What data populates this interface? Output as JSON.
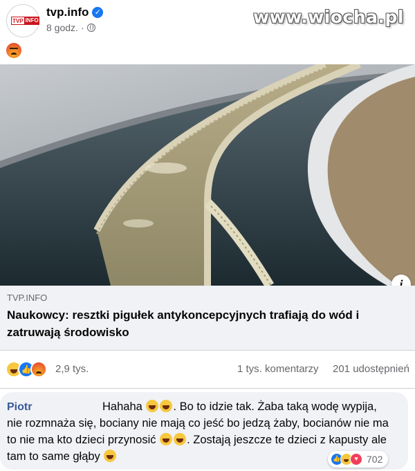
{
  "post": {
    "page_name": "tvp.info",
    "time": "8 godz.",
    "separator": "·",
    "avatar_logo_left": "TVP",
    "avatar_logo_right": "INFO",
    "verified_icon": "check-icon",
    "privacy_icon": "globe-icon",
    "header_emoji": "angry-icon"
  },
  "watermark": "www.wiocha.pl",
  "link": {
    "domain": "TVP.INFO",
    "title": "Naukowcy: resztki pigułek antykoncepcyjnych trafiają do wód i zatruwają środowisko",
    "info_label": "i"
  },
  "reactions": {
    "icons": [
      "laugh-icon",
      "like-icon",
      "angry-icon"
    ],
    "count": "2,9 tys.",
    "comments": "1 tys. komentarzy",
    "shares": "201 udostępnień"
  },
  "comment": {
    "author": "Piotr",
    "text_part1": "Hahaha",
    "text_part2": ". Bo to idzie tak. Żaba taką wodę wypija, nie rozmnaża się, bociany nie mają co jeść bo jedzą żaby, bocianów nie ma to nie ma kto dzieci przynosić",
    "text_part3": ". Zostają jeszcze te dzieci z kapusty ale tam to same głąby",
    "reaction_icons": [
      "like-icon",
      "laugh-icon",
      "love-icon"
    ],
    "reaction_count": "702"
  },
  "colors": {
    "brand_blue": "#1877f2",
    "author_blue": "#385898",
    "bubble_bg": "#f0f2f5",
    "muted_text": "#65676b",
    "tvp_red": "#c9141c"
  }
}
